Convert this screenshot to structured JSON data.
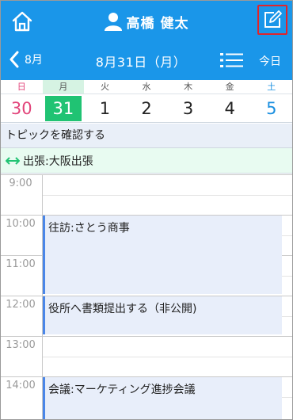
{
  "header": {
    "user_name": "高橋 健太",
    "prev_label": "8月",
    "date_title": "8月31日（月）",
    "today_label": "今日",
    "accent_color": "#1a96e9",
    "highlight_color": "#e0242b"
  },
  "week": [
    {
      "dow": "日",
      "num": "30"
    },
    {
      "dow": "月",
      "num": "31"
    },
    {
      "dow": "火",
      "num": "1"
    },
    {
      "dow": "水",
      "num": "2"
    },
    {
      "dow": "木",
      "num": "3"
    },
    {
      "dow": "金",
      "num": "4"
    },
    {
      "dow": "土",
      "num": "5"
    }
  ],
  "topic_label": "トピックを確認する",
  "allday_event": "出張:大阪出張",
  "hours": [
    "9:00",
    "10:00",
    "11:00",
    "12:00",
    "13:00",
    "14:00"
  ],
  "events": [
    {
      "title": "往訪:さとう商事"
    },
    {
      "title": "役所へ書類提出する（非公開)"
    },
    {
      "title": "会議:マーケティング進捗会議"
    }
  ],
  "icons": {
    "home": "home-icon",
    "user": "user-icon",
    "edit": "edit-icon",
    "prev": "chevron-left-icon",
    "list": "list-icon",
    "allday": "double-arrow-icon"
  }
}
